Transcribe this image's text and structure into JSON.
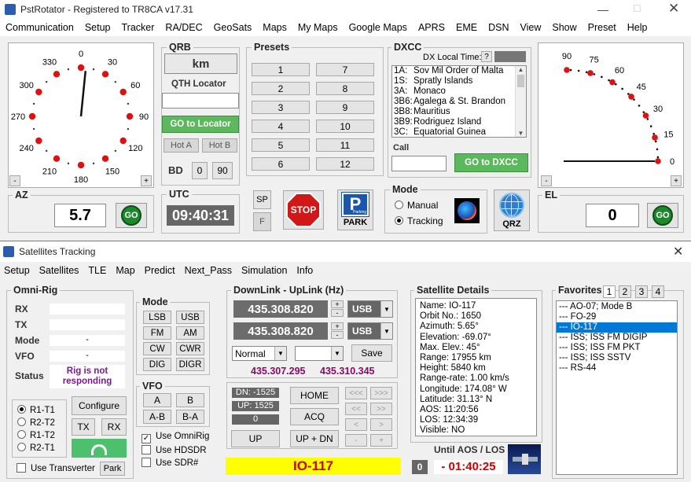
{
  "top": {
    "title": "PstRotator - Registered to TR8CA   v17.31",
    "menu": [
      "Communication",
      "Setup",
      "Tracker",
      "RA/DEC",
      "GeoSats",
      "Maps",
      "My Maps",
      "Google Maps",
      "APRS",
      "EME",
      "DSN",
      "View",
      "Show",
      "Preset",
      "Help"
    ],
    "az": {
      "label": "AZ",
      "value": "5.7",
      "go": "GO",
      "ticks": [
        "0",
        "30",
        "60",
        "90",
        "120",
        "150",
        "180",
        "210",
        "240",
        "270",
        "300",
        "330"
      ],
      "minus": "-",
      "plus": "+"
    },
    "el": {
      "label": "EL",
      "value": "0",
      "go": "GO",
      "ticks": [
        "90",
        "75",
        "60",
        "45",
        "30",
        "15",
        "0"
      ],
      "minus": "-",
      "plus": "+"
    },
    "qrb": {
      "label": "QRB",
      "unit": "km",
      "qth_label": "QTH Locator",
      "qth_value": "",
      "go_locator": "GO to Locator",
      "hot_a": "Hot A",
      "hot_b": "Hot B",
      "bd_label": "BD",
      "bd0": "0",
      "bd90": "90"
    },
    "presets": {
      "label": "Presets",
      "buttons": [
        "1",
        "7",
        "2",
        "8",
        "3",
        "9",
        "4",
        "10",
        "5",
        "11",
        "6",
        "12"
      ]
    },
    "dxcc": {
      "label": "DXCC",
      "local_time_label": "DX Local Time:",
      "help": "?",
      "entries": [
        [
          "1A:",
          "Sov Mil Order of Malta"
        ],
        [
          "1S:",
          "Spratly Islands"
        ],
        [
          "3A:",
          "Monaco"
        ],
        [
          "3B6:",
          "Agalega & St. Brandon"
        ],
        [
          "3B8:",
          "Mauritius"
        ],
        [
          "3B9:",
          "Rodriguez Island"
        ],
        [
          "3C:",
          "Equatorial Guinea"
        ]
      ],
      "call_label": "Call",
      "call_value": "",
      "go_dxcc": "GO to DXCC"
    },
    "utc": {
      "label": "UTC",
      "time": "09:40:31"
    },
    "sp": "SP",
    "f": "F",
    "stop": "STOP",
    "park": "PARK",
    "parking": "Parking",
    "mode": {
      "label": "Mode",
      "manual": "Manual",
      "tracking": "Tracking"
    },
    "qrz": "QRZ"
  },
  "sat": {
    "title": "Satellites Tracking",
    "menu": [
      "Setup",
      "Satellites",
      "TLE",
      "Map",
      "Predict",
      "Next_Pass",
      "Simulation",
      "Info"
    ],
    "omni": {
      "label": "Omni-Rig",
      "rx": "RX",
      "tx": "TX",
      "mode": "Mode",
      "mode_val": "-",
      "vfo": "VFO",
      "vfo_val": "-",
      "status": "Status",
      "status_val": "Rig is not responding",
      "rigs": [
        "R1-T1",
        "R2-T2",
        "R1-T2",
        "R2-T1"
      ],
      "configure": "Configure",
      "txb": "TX",
      "rxb": "RX",
      "use_transverter": "Use Transverter",
      "park": "Park"
    },
    "modes": {
      "label": "Mode",
      "buttons": [
        "LSB",
        "USB",
        "FM",
        "AM",
        "CW",
        "CWR",
        "DIG",
        "DIGR"
      ]
    },
    "vfo": {
      "label": "VFO",
      "buttons": [
        "A",
        "B",
        "A-B",
        "B-A"
      ],
      "use_omnirig": "Use OmniRig",
      "use_hdsdr": "Use HDSDR",
      "use_sdr": "Use SDR#"
    },
    "downlink": {
      "label": "DownLink - UpLink (Hz)",
      "down": "435.308.820",
      "up": "435.308.820",
      "down_mode": "USB",
      "up_mode": "USB",
      "normal": "Normal",
      "save": "Save",
      "f1": "435.307.295",
      "f2": "435.310.345"
    },
    "dn": "DN: -1525",
    "upv": "UP: 1525",
    "zero": "0",
    "home": "HOME",
    "acq": "ACQ",
    "up_btn": "UP",
    "up_dn": "UP + DN",
    "arrows": [
      "<<<",
      ">>>",
      "<<",
      ">>",
      "<",
      ">",
      "-",
      "+"
    ],
    "sat_name": "IO-117",
    "details": {
      "label": "Satellite Details",
      "lines": [
        "Name: IO-117",
        "Orbit No.: 1650",
        "Azimuth: 5.65°",
        "Elevation: -69.07°",
        "Max. Elev.:  45°",
        "Range:  17955 km",
        "Height:  5840 km",
        "Range-rate: 1.00 km/s",
        "Longitude: 174.08° W",
        "Latitude: 31.13° N",
        "AOS: 11:20:56",
        "LOS: 12:34:39",
        "Visible: NO"
      ]
    },
    "until": "Until AOS / LOS",
    "until_n": "0",
    "countdown": "- 01:40:25",
    "favorites": {
      "label": "Favorites",
      "tabs": [
        "1",
        "2",
        "3",
        "4"
      ],
      "items": [
        "--- AO-07; Mode B",
        "--- FO-29",
        "--- IO-117",
        "--- ISS; ISS FM DIGIP",
        "--- ISS; ISS FM PKT",
        "--- ISS; ISS SSTV",
        "--- RS-44"
      ],
      "selected": 2
    }
  },
  "colors": {
    "accent_green": "#5cb85c",
    "selection": "#0078d7",
    "sat_yellow": "#ffff00",
    "freq_purple": "#8a0a6a"
  }
}
